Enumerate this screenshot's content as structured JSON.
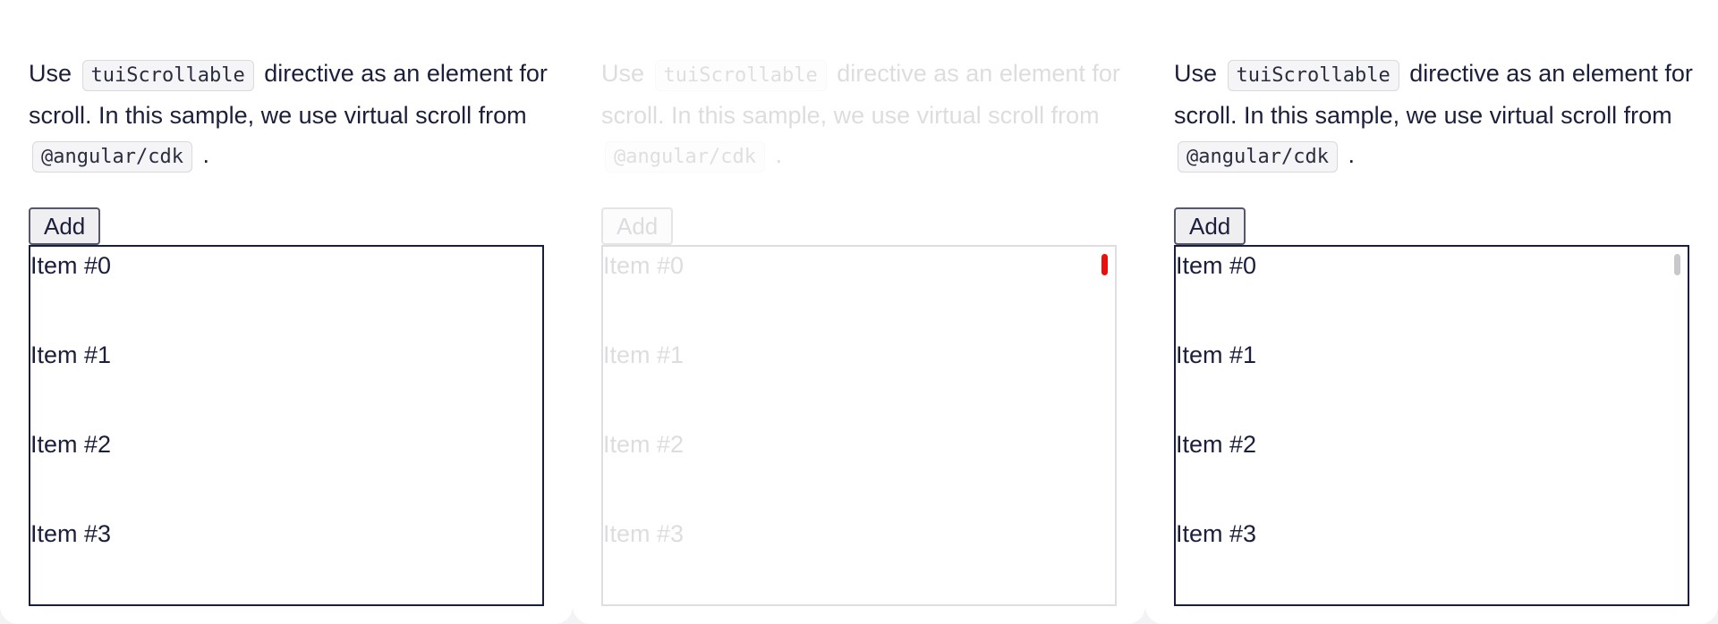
{
  "description": {
    "use": "Use",
    "directive_code": "tuiScrollable",
    "text_mid": "directive as an element for scroll. In this sample, we use virtual scroll from",
    "package_code": "@angular/cdk",
    "end": "."
  },
  "add_button_label": "Add",
  "items": [
    "Item #0",
    "Item #1",
    "Item #2",
    "Item #3"
  ],
  "colors": {
    "text": "#1b1f3b",
    "scroll_thumb_highlight": "#e8120c",
    "scroll_thumb": "#c7c8cc"
  }
}
